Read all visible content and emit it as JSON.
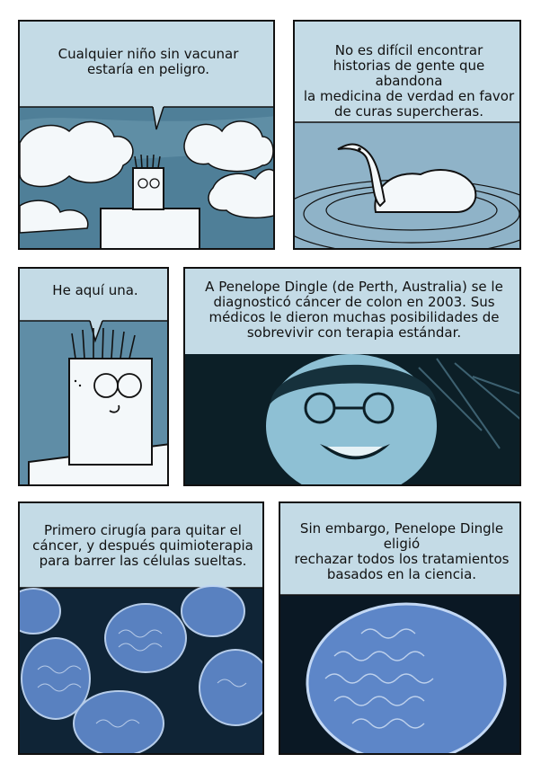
{
  "panels": [
    {
      "id": "p1",
      "caption": "Cualquier niño sin vacunar\nestaría en peligro."
    },
    {
      "id": "p2",
      "caption": "No es difícil encontrar\nhistorias de gente que abandona\nla medicina de verdad en favor\nde curas supercheras."
    },
    {
      "id": "p3",
      "caption": "He aquí una."
    },
    {
      "id": "p4",
      "caption": "A Penelope Dingle (de Perth, Australia) se le\ndiagnosticó cáncer de colon en 2003. Sus\nmédicos le dieron muchas posibilidades de\nsobrevivir con terapia estándar."
    },
    {
      "id": "p5",
      "caption": "Primero cirugía para quitar el\ncáncer, y después quimioterapia\npara barrer las células sueltas."
    },
    {
      "id": "p6",
      "caption": "Sin embargo, Penelope Dingle eligió\nrechazar todos los tratamientos\nbasados en la ciencia."
    }
  ],
  "colors": {
    "panel_bg": "#c4dbe6",
    "sky_dark": "#3f6f88",
    "water": "#8fb3c8",
    "ink": "#111111",
    "cell_blue": "#5d86c8"
  }
}
